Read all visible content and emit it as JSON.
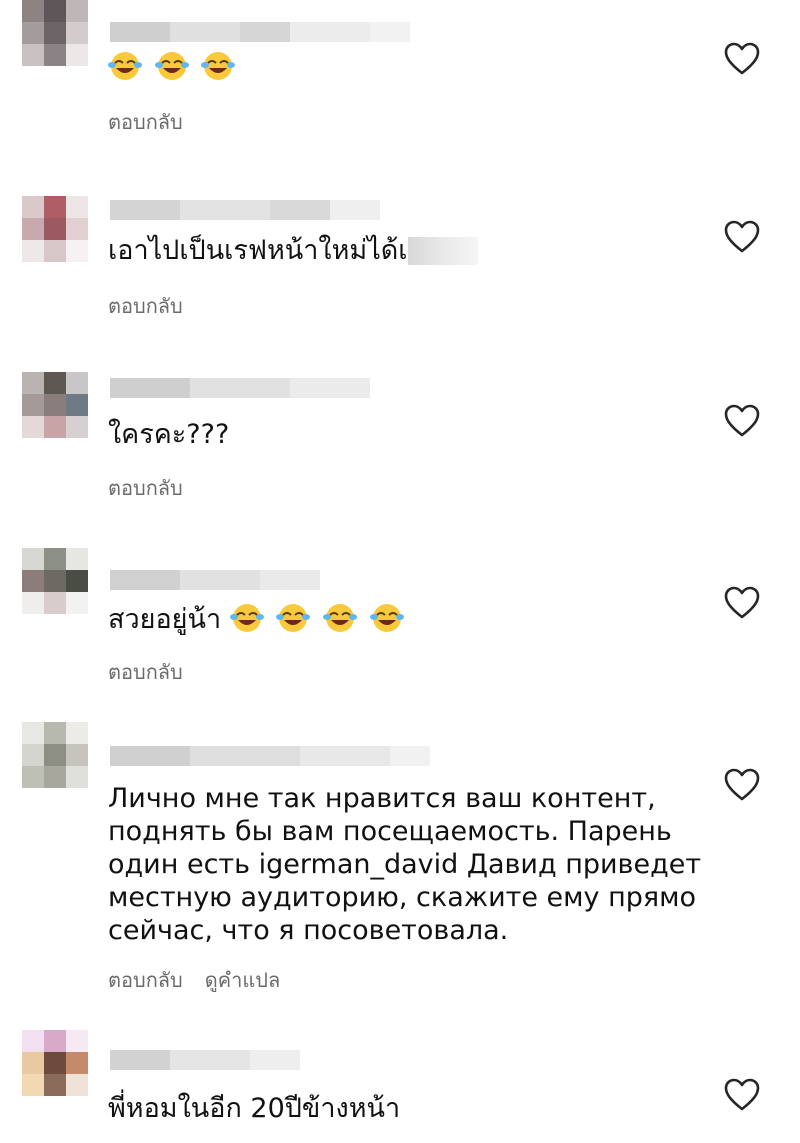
{
  "comments": [
    {
      "text": "",
      "reply": "ตอบกลับ",
      "emoji_count": 3
    },
    {
      "text": "เอาไปเป็นเรฟหน้าใหม่ได้เ",
      "reply": "ตอบกลับ"
    },
    {
      "text": "ใครคะ???",
      "reply": "ตอบกลับ"
    },
    {
      "text": "สวยอยู่น้า",
      "reply": "ตอบกลับ",
      "emoji_count": 4
    },
    {
      "text": "Лично мне так нравится ваш контент, поднять бы вам посещаемость. Парень один есть igerman_david Давид приведет местную аудиторию, скажите ему прямо сейчас, что я посоветовала.",
      "reply": "ตอบกลับ",
      "translate": "ดูคำแปล"
    },
    {
      "text": "พี่หอมในอีก 20ปีข้างหน้า"
    }
  ],
  "icons": {
    "like": "heart-outline-icon",
    "emoji": "face-with-tears-of-joy-icon"
  }
}
